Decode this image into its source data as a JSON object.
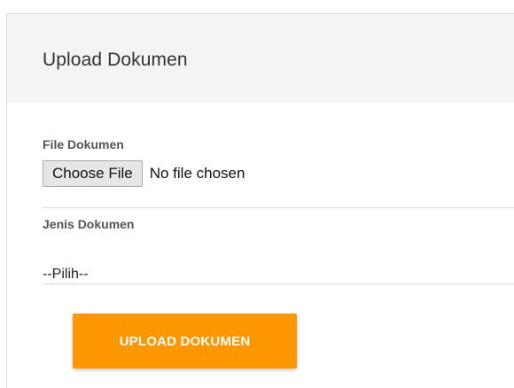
{
  "card": {
    "title": "Upload Dokumen"
  },
  "file_field": {
    "label": "File Dokumen",
    "button_label": "Choose File",
    "status": "No file chosen"
  },
  "type_field": {
    "label": "Jenis Dokumen",
    "selected": "--Pilih--"
  },
  "submit": {
    "label": "UPLOAD DOKUMEN"
  },
  "colors": {
    "accent": "#ff9800",
    "header_bg": "#f4f4f4",
    "divider": "#d9d9d9"
  }
}
